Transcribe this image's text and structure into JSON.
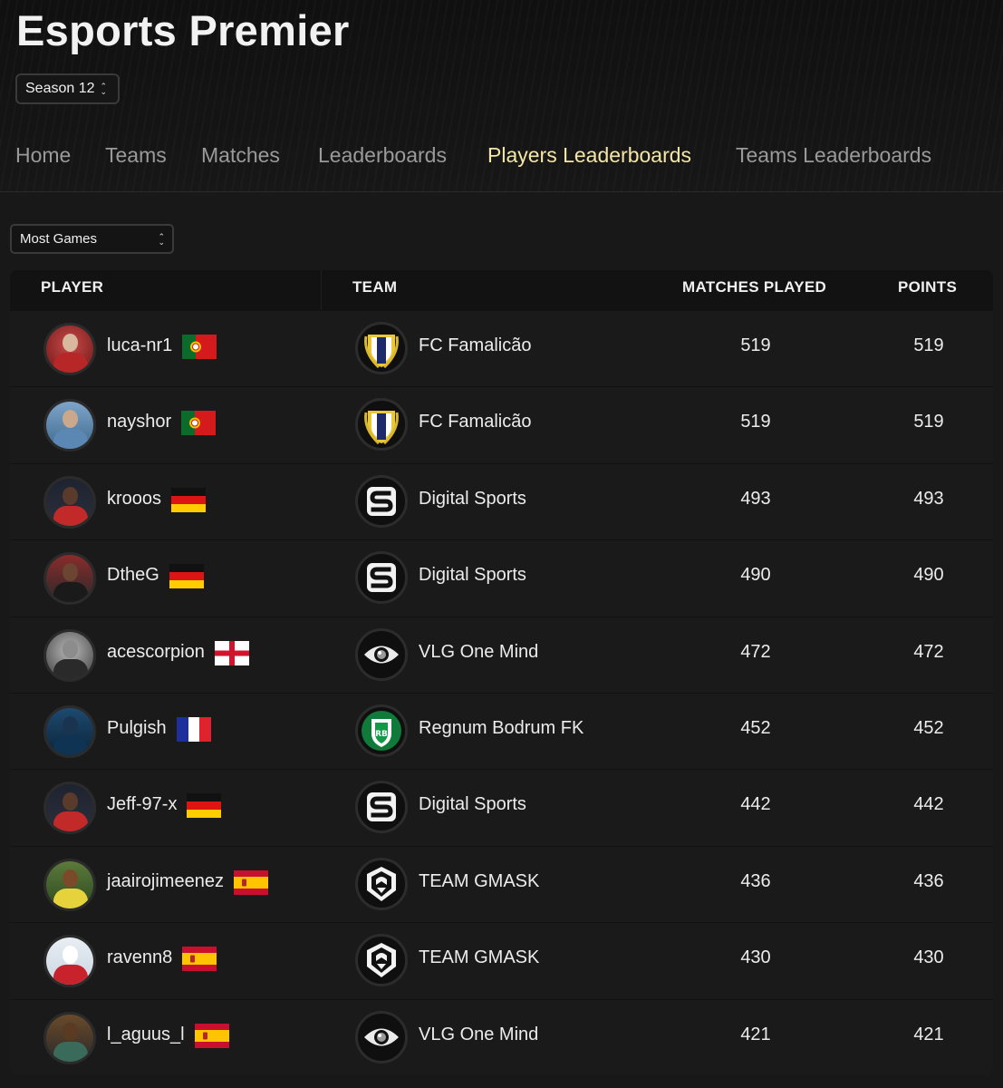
{
  "app": {
    "title": "Esports Premier"
  },
  "season": {
    "selected": "Season 12"
  },
  "nav": {
    "tabs": [
      {
        "label": "Home",
        "active": false
      },
      {
        "label": "Teams",
        "active": false
      },
      {
        "label": "Matches",
        "active": false
      },
      {
        "label": "Leaderboards",
        "active": false
      },
      {
        "label": "Players Leaderboards",
        "active": true
      },
      {
        "label": "Teams Leaderboards",
        "active": false
      }
    ]
  },
  "sort": {
    "selected": "Most Games"
  },
  "table": {
    "headers": {
      "player": "PLAYER",
      "team": "TEAM",
      "matches": "MATCHES PLAYED",
      "points": "POINTS"
    },
    "rows": [
      {
        "player": "luca-nr1",
        "flag": "portugal-flag",
        "team": "FC Famalicão",
        "team_logo": "famalicao-crest-icon",
        "matches": "519",
        "points": "519"
      },
      {
        "player": "nayshor",
        "flag": "portugal-flag",
        "team": "FC Famalicão",
        "team_logo": "famalicao-crest-icon",
        "matches": "519",
        "points": "519"
      },
      {
        "player": "krooos",
        "flag": "germany-flag",
        "team": "Digital Sports",
        "team_logo": "digital-sports-s-icon",
        "matches": "493",
        "points": "493"
      },
      {
        "player": "DtheG",
        "flag": "germany-flag",
        "team": "Digital Sports",
        "team_logo": "digital-sports-s-icon",
        "matches": "490",
        "points": "490"
      },
      {
        "player": "acescorpion",
        "flag": "england-flag",
        "team": "VLG One Mind",
        "team_logo": "vlg-eye-icon",
        "matches": "472",
        "points": "472"
      },
      {
        "player": "Pulgish",
        "flag": "france-flag",
        "team": "Regnum Bodrum FK",
        "team_logo": "bodrum-shield-icon",
        "matches": "452",
        "points": "452"
      },
      {
        "player": "Jeff-97-x",
        "flag": "germany-flag",
        "team": "Digital Sports",
        "team_logo": "digital-sports-s-icon",
        "matches": "442",
        "points": "442"
      },
      {
        "player": "jaairojimeenez",
        "flag": "spain-flag",
        "team": "TEAM GMASK",
        "team_logo": "gmask-mask-icon",
        "matches": "436",
        "points": "436"
      },
      {
        "player": "ravenn8",
        "flag": "spain-flag",
        "team": "TEAM GMASK",
        "team_logo": "gmask-mask-icon",
        "matches": "430",
        "points": "430"
      },
      {
        "player": "l_aguus_l",
        "flag": "spain-flag",
        "team": "VLG One Mind",
        "team_logo": "vlg-eye-icon",
        "matches": "421",
        "points": "421"
      }
    ]
  },
  "colors": {
    "background": "#181818",
    "active_tab": "#f3e6a6",
    "inactive_tab": "#9a9a9a",
    "row_bg": "#1a1a1a",
    "header_bg": "#121212"
  }
}
